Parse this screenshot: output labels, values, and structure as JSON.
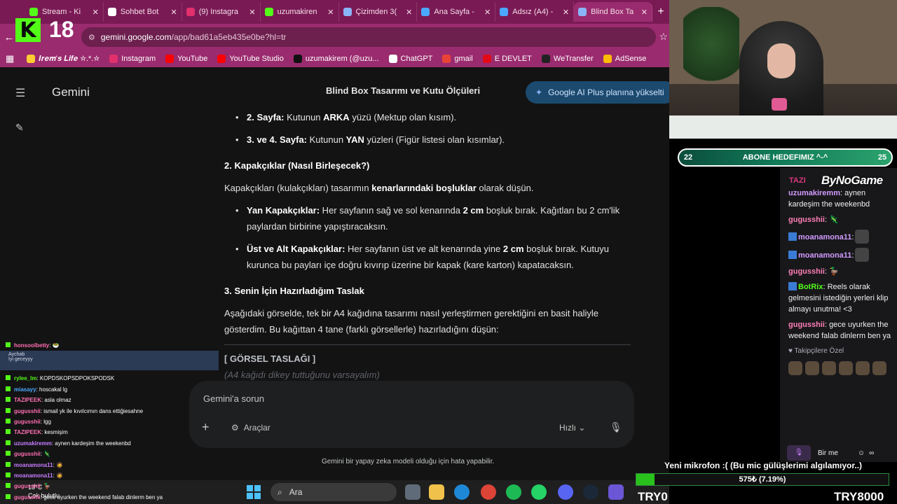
{
  "browser": {
    "tabs": [
      {
        "label": "Stream - Ki",
        "color": "#53fc18"
      },
      {
        "label": "Sohbet Bot",
        "color": "#ffffff"
      },
      {
        "label": "(9) Instagra",
        "color": "#e1306c"
      },
      {
        "label": "uzumakiren",
        "color": "#53fc18"
      },
      {
        "label": "Çizimden 3(",
        "color": "#8ab4f8"
      },
      {
        "label": "Ana Sayfa -",
        "color": "#4aa8ff"
      },
      {
        "label": "Adsız (A4) -",
        "color": "#4aa8ff"
      },
      {
        "label": "Blind Box Ta",
        "color": "#8ab4f8",
        "active": true
      }
    ],
    "close_glyph": "✕",
    "new_tab_glyph": "+",
    "url_host": "gemini.google.com",
    "url_path": "/app/bad61a5eb435e0be?hl=tr",
    "bookmarks": [
      {
        "label": "𝑰𝒓𝒆𝒎'𝒔 𝑳𝒊𝒇𝒆 ☆.*.☆",
        "color": "#ffcc33"
      },
      {
        "label": "Instagram",
        "color": "#e1306c"
      },
      {
        "label": "YouTube",
        "color": "#ff0000"
      },
      {
        "label": "YouTube Studio",
        "color": "#ff0000"
      },
      {
        "label": "uzumakirem (@uzu...",
        "color": "#111111"
      },
      {
        "label": "ChatGPT",
        "color": "#ffffff"
      },
      {
        "label": "gmail",
        "color": "#ea4335"
      },
      {
        "label": "E DEVLET",
        "color": "#e30a17"
      },
      {
        "label": "WeTransfer",
        "color": "#222222"
      },
      {
        "label": "AdSense",
        "color": "#fbbc04"
      }
    ]
  },
  "gemini": {
    "brand": "Gemini",
    "conversation_title": "Blind Box Tasarımı ve Kutu Ölçüleri",
    "upgrade_label": "Google AI Plus planına yükselti",
    "content": {
      "p1_strong": "2. Sayfa:",
      "p1_a": " Kutunun ",
      "p1_b": "ARKA",
      "p1_c": " yüzü (Mektup olan kısım).",
      "p2_strong": "3. ve 4. Sayfa:",
      "p2_a": " Kutunun ",
      "p2_b": "YAN",
      "p2_c": " yüzleri (Figür listesi olan kısımlar).",
      "h2": "2. Kapakçıklar (Nasıl Birleşecek?)",
      "p3_a": "Kapakçıkları (kulakçıkları) tasarımın ",
      "p3_b": "kenarlarındaki boşluklar",
      "p3_c": " olarak düşün.",
      "b1_strong": "Yan Kapakçıklar:",
      "b1_a": " Her sayfanın sağ ve sol kenarında ",
      "b1_b": "2 cm",
      "b1_c": " boşluk bırak. Kağıtları bu 2 cm'lik paylardan birbirine yapıştıracaksın.",
      "b2_strong": "Üst ve Alt Kapakçıklar:",
      "b2_a": " Her sayfanın üst ve alt kenarında yine ",
      "b2_b": "2 cm",
      "b2_c": " boşluk bırak. Kutuyu kurunca bu payları içe doğru kıvırıp üzerine bir kapak (kare karton) kapatacaksın.",
      "h3": "3. Senin İçin Hazırladığım Taslak",
      "p4": "Aşağıdaki görselde, tek bir A4 kağıdına tasarımı nasıl yerleştirmen gerektiğini en basit haliyle gösterdim. Bu kağıttan 4 tane (farklı görsellerle) hazırladığını düşün:",
      "draft_label": "[ GÖRSEL TASLAĞI ]",
      "faint_line": "(A4 kağıdı dikey tuttuğunu varsayalım)"
    },
    "prompt_placeholder": "Gemini'a sorun",
    "tools_label": "Araçlar",
    "model_label": "Hızlı",
    "disclaimer": "Gemini bir yapay zeka modeli olduğu için hata yapabilir."
  },
  "overlay": {
    "k_logo": "K",
    "age_badge": "18",
    "left_chat": [
      {
        "user": "honsoolbetty",
        "color": "#ff6fb1",
        "msg": ": 🥗"
      },
      {
        "user": "rylee_lm",
        "color": "#53fc18",
        "msg": ": KOPDSKOPSDPOKSPODSK"
      },
      {
        "user": "miasayy",
        "color": "#4aa8ff",
        "msg": ": hoscakal lg"
      },
      {
        "user": "TAZIPEEK",
        "color": "#ff6fb1",
        "msg": ": asla olmaz"
      },
      {
        "user": "gugusshii",
        "color": "#ff6fb1",
        "msg": ": ismail yk ile kıvılcımın dans ettiğiesahne"
      },
      {
        "user": "gugusshii",
        "color": "#ff6fb1",
        "msg": ": lgg"
      },
      {
        "user": "TAZIPEEK",
        "color": "#ff6fb1",
        "msg": ": kesmişim"
      },
      {
        "user": "uzumakiremm",
        "color": "#c77dff",
        "msg": ": aynen kardeşim the weekenbd"
      },
      {
        "user": "gugusshii",
        "color": "#ff6fb1",
        "msg": ": 🦎"
      },
      {
        "user": "moanamona11",
        "color": "#c77dff",
        "msg": ": 🧔"
      },
      {
        "user": "moanamona11",
        "color": "#c77dff",
        "msg": ": 🧔"
      },
      {
        "user": "gugusshii",
        "color": "#ff6fb1",
        "msg": ": 🦆"
      },
      {
        "user": "gugusshii",
        "color": "#ff6fb1",
        "msg": ": gece uyurken the weekend falab dinlerm ben ya"
      }
    ],
    "left_highlight_user": "Aychab",
    "left_highlight_msg": "İyi geceyyy",
    "goal_left": "22",
    "goal_label": "ABONE HEDEFIMIZ ^-^",
    "goal_right": "25",
    "logo_text": "ByNoGame",
    "tazi_text": "TAZI",
    "right_chat": [
      {
        "user": "uzumakiremm",
        "color": "purple",
        "msg": ": aynen kardeşim the weekenbd"
      },
      {
        "user": "gugusshii",
        "color": "pink",
        "msg": ": 🦎"
      },
      {
        "user": "moanamona11",
        "color": "purple",
        "msg": ":"
      },
      {
        "user": "moanamona11",
        "color": "purple",
        "msg": ":"
      },
      {
        "user": "gugusshii",
        "color": "pink",
        "msg": ": 🦆"
      },
      {
        "user": "BotRix",
        "color": "green",
        "msg": ": Reels olarak gelmesini istediğin yerleri klip almayı unutma! <3"
      },
      {
        "user": "gugusshii",
        "color": "pink",
        "msg": ": gece uyurken the weekend falab dinlerm ben ya"
      }
    ],
    "followers_label": "♥ Takipçilere Özel",
    "mic_label": "Bir me",
    "ticker": "Yeni mikrofon :( (Bu mic gülüşlerimi algılamıyor..)",
    "donation_text": "575₺ (7.19%)",
    "donation_progress": 0.0719,
    "try_left": "TRY0",
    "try_right": "TRY8000"
  },
  "taskbar": {
    "weather_temp": "13°C",
    "weather_desc": "Çok bulutlu",
    "search_label": "Ara"
  }
}
